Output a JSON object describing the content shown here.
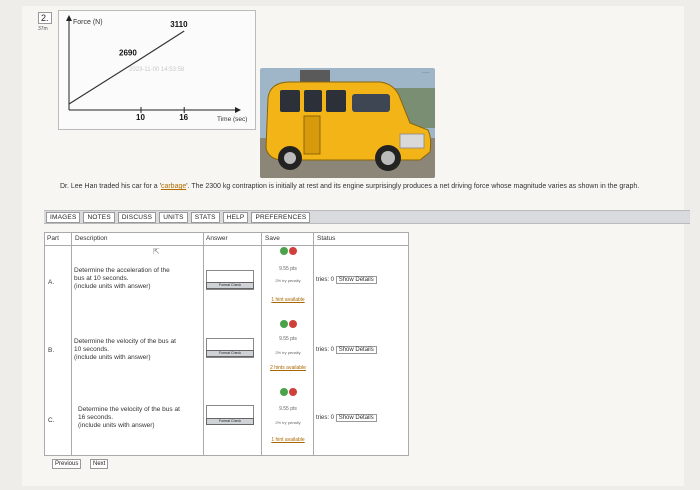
{
  "question": {
    "number": "2.",
    "subnumber": "37m"
  },
  "chart_data": {
    "type": "line",
    "ylabel": "Force (N)",
    "xlabel": "Time (sec)",
    "x": [
      0,
      10,
      16
    ],
    "y": [
      2000,
      2690,
      3110
    ],
    "point_labels": [
      "2690",
      "3110"
    ],
    "x_tick_labels": [
      "10",
      "16"
    ],
    "grid": false,
    "legend": "none"
  },
  "watermark": "2023-11-00 14:53:58",
  "barcode_text": "....",
  "problem": {
    "prefix": "Dr. Lee Han traded his car for a '",
    "link": "carbage",
    "suffix": "'. The 2300 kg contraption is initially at rest and its engine surprisingly produces a net driving force whose magnitude varies as shown in the graph."
  },
  "tabs": [
    "IMAGES",
    "NOTES",
    "DISCUSS",
    "UNITS",
    "STATS",
    "HELP",
    "PREFERENCES"
  ],
  "table": {
    "headers": {
      "part": "Part",
      "description": "Description",
      "answer": "Answer",
      "save": "Save",
      "status": "Status"
    },
    "rows": [
      {
        "label": "A.",
        "desc1": "Determine the acceleration of the",
        "desc2": "bus at 10 seconds.",
        "desc3": "(include units with answer)",
        "format_btn": "Format Check",
        "pts": "9.55 pts",
        "penalty": "2% try penalty",
        "hint": "1 hint available",
        "tries": "tries: 0",
        "details": "Show Details"
      },
      {
        "label": "B.",
        "desc1": "Determine the velocity of the bus at",
        "desc2": "10 seconds.",
        "desc3": "(include units with answer)",
        "format_btn": "Format Check",
        "pts": "9.55 pts",
        "penalty": "2% try penalty",
        "hint": "2 hints available",
        "tries": "tries: 0",
        "details": "Show Details"
      },
      {
        "label": "C.",
        "desc1": "Determine the velocity of the bus at",
        "desc2": "16 seconds.",
        "desc3": "(include units with answer)",
        "format_btn": "Format Check",
        "pts": "9.55 pts",
        "penalty": "2% try penalty",
        "hint": "1 hint available",
        "tries": "tries: 0",
        "details": "Show Details"
      }
    ]
  },
  "nav": {
    "previous": "Previous",
    "next": "Next"
  }
}
